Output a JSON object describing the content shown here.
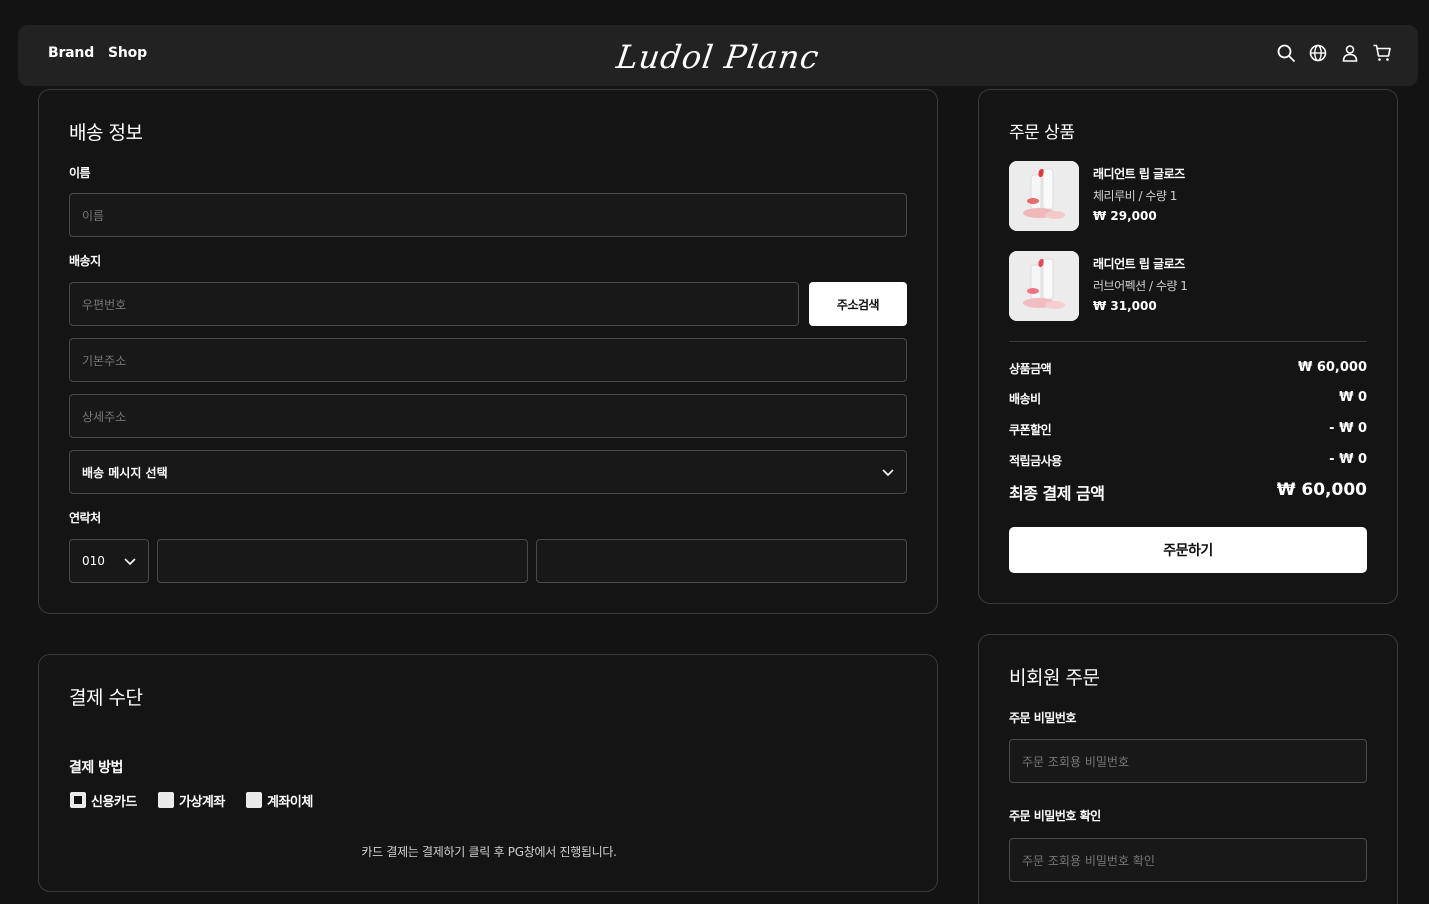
{
  "header": {
    "nav": [
      "Brand",
      "Shop"
    ],
    "logo": "Ludol Planc",
    "icons": [
      "search-icon",
      "globe-icon",
      "user-icon",
      "cart-icon"
    ]
  },
  "shipping": {
    "title": "배송 정보",
    "name_label": "이름",
    "name_placeholder": "이름",
    "address_label": "배송지",
    "postcode_placeholder": "우편번호",
    "address_search_button": "주소검색",
    "address_placeholder": "기본주소",
    "detail_placeholder": "상세주소",
    "message_select": "배송 메시지 선택",
    "contact_label": "연락처",
    "phone_prefix": "010"
  },
  "payment": {
    "title": "결제 수단",
    "method_label": "결제 방법",
    "options": [
      {
        "label": "신용카드",
        "checked": true
      },
      {
        "label": "가상계좌",
        "checked": false
      },
      {
        "label": "계좌이체",
        "checked": false
      }
    ],
    "note": "카드 결제는 결제하기 클릭 후 PG창에서 진행됩니다."
  },
  "order": {
    "title": "주문 상품",
    "items": [
      {
        "name": "래디언트 립 글로즈",
        "option": "체리루비 / 수량 1",
        "price": "₩ 29,000"
      },
      {
        "name": "래디언트 립 글로즈",
        "option": "러브어펙션 / 수량 1",
        "price": "₩ 31,000"
      }
    ],
    "summary": [
      {
        "label": "상품금액",
        "value": "₩ 60,000"
      },
      {
        "label": "배송비",
        "value": "₩ 0"
      },
      {
        "label": "쿠폰할인",
        "value": "- ₩ 0"
      },
      {
        "label": "적립금사용",
        "value": "- ₩ 0"
      }
    ],
    "total_label": "최종 결제 금액",
    "total_value": "₩ 60,000",
    "order_button": "주문하기"
  },
  "guest": {
    "title": "비회원 주문",
    "password_label": "주문 비밀번호",
    "password_placeholder": "주문 조회용 비밀번호",
    "confirm_label": "주문 비밀번호 확인",
    "confirm_placeholder": "주문 조회용 비밀번호 확인"
  }
}
